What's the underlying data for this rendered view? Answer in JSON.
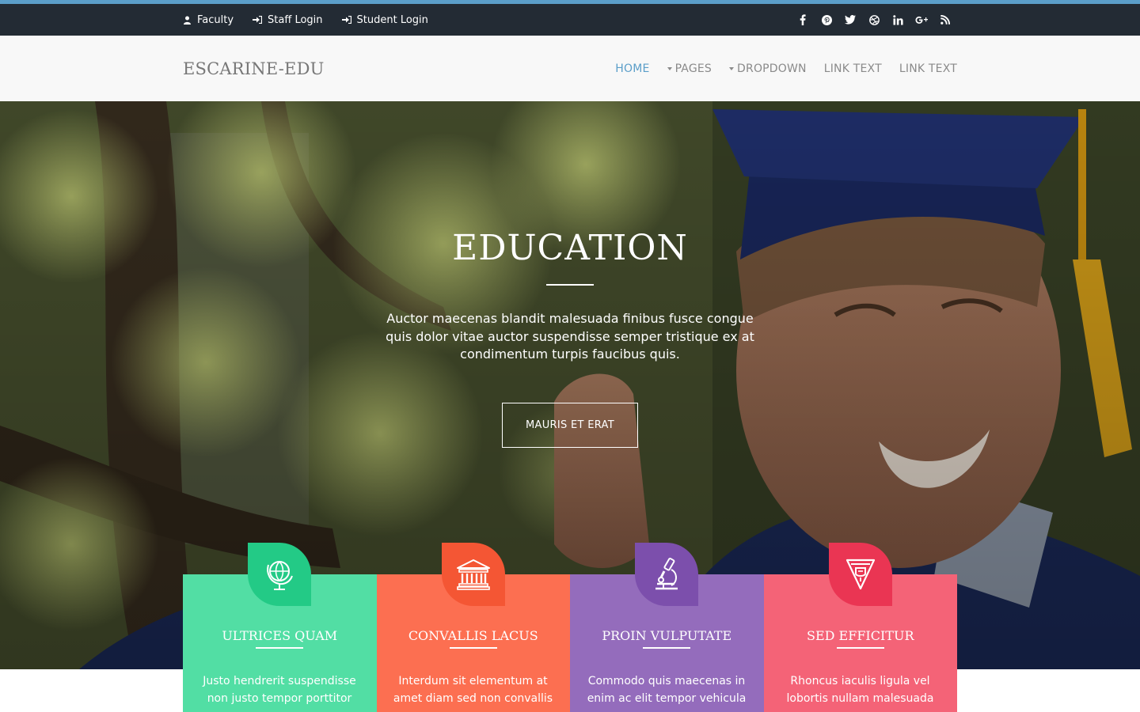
{
  "colors": {
    "accent_strip": "#5b9ec9",
    "topbar_bg": "#232b34",
    "header_bg": "#f8f8f8",
    "nav_active": "#5b9ec9",
    "nav_text": "#8a8a8a"
  },
  "topbar": {
    "links": [
      {
        "label": "Faculty",
        "icon": "user-icon"
      },
      {
        "label": "Staff Login",
        "icon": "sign-in-icon"
      },
      {
        "label": "Student Login",
        "icon": "sign-in-icon"
      }
    ],
    "social": [
      "facebook-icon",
      "pinterest-icon",
      "twitter-icon",
      "dribbble-icon",
      "linkedin-icon",
      "google-plus-icon",
      "rss-icon"
    ]
  },
  "header": {
    "logo": "ESCARINE-EDU",
    "nav": [
      {
        "label": "HOME",
        "active": true
      },
      {
        "label": "PAGES",
        "dropdown": true
      },
      {
        "label": "DROPDOWN",
        "dropdown": true
      },
      {
        "label": "LINK TEXT"
      },
      {
        "label": "LINK TEXT"
      }
    ]
  },
  "hero": {
    "title": "EDUCATION",
    "text": "Auctor maecenas blandit malesuada finibus fusce congue quis dolor vitae auctor suspendisse semper tristique ex at condimentum turpis faucibus quis.",
    "button": "MAURIS ET ERAT"
  },
  "cards": [
    {
      "title": "ULTRICES QUAM",
      "text": "Justo hendrerit suspendisse non justo tempor porttitor",
      "icon": "globe-icon",
      "color": "#52dea4",
      "badge": "#23ca86"
    },
    {
      "title": "CONVALLIS LACUS",
      "text": "Interdum sit elementum at amet diam sed non convallis",
      "icon": "bank-icon",
      "color": "#fc6f51",
      "badge": "#f45634"
    },
    {
      "title": "PROIN VULPUTATE",
      "text": "Commodo quis maecenas in enim ac elit tempor vehicula",
      "icon": "microscope-icon",
      "color": "#946cbc",
      "badge": "#7c4fac"
    },
    {
      "title": "SED EFFICITUR",
      "text": "Rhoncus iaculis ligula vel lobortis nullam malesuada",
      "icon": "pennant-icon",
      "color": "#f46377",
      "badge": "#ea3553"
    }
  ]
}
